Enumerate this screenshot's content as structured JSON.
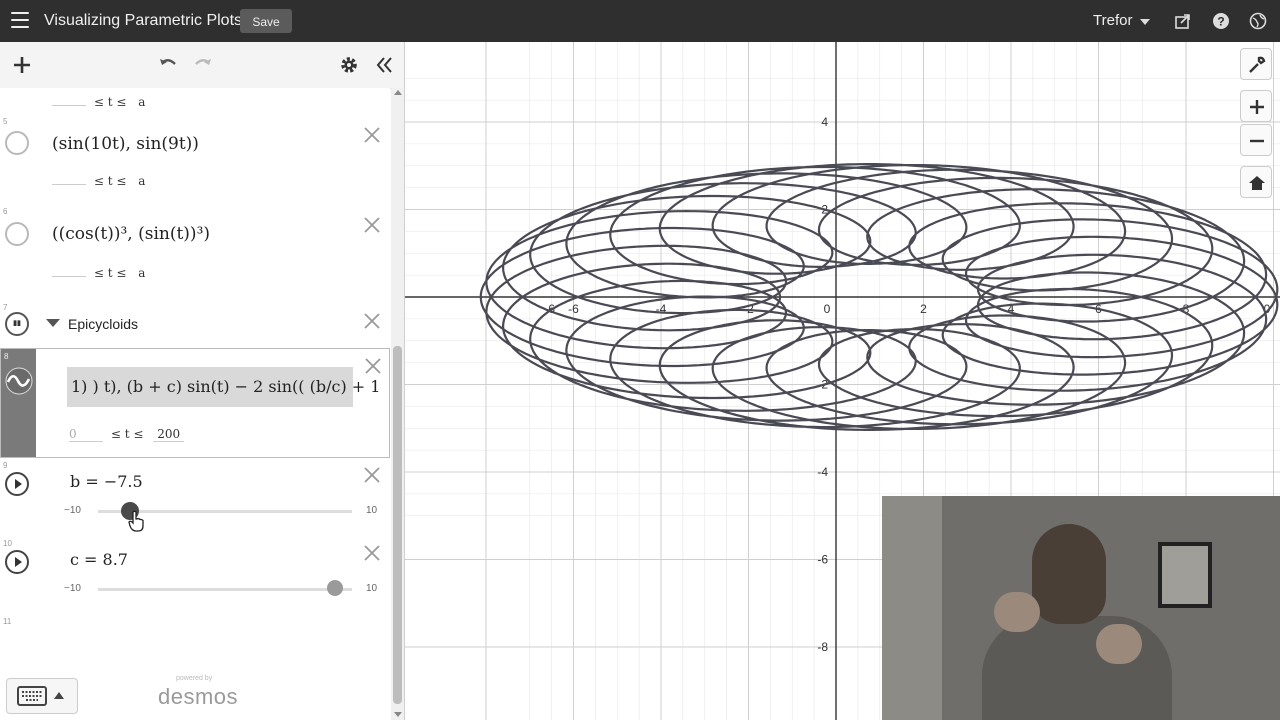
{
  "header": {
    "title": "Visualizing Parametric Plots",
    "save_label": "Save",
    "user": "Trefor"
  },
  "list": {
    "items": [
      {
        "range_hi": "a"
      },
      {
        "num": "5",
        "expr": "(sin(10t), sin(9t))",
        "range_hi": "a"
      },
      {
        "num": "6",
        "expr": "((cos(t))³, (sin(t))³)",
        "range_hi": "a"
      },
      {
        "num": "7",
        "folder": "Epicycloids"
      },
      {
        "num": "8",
        "expr": "1) ) t), (b + c) sin(t) − 2 sin(( (b/c) + 1",
        "range_lo": "0",
        "range_hi": "200"
      },
      {
        "num": "9",
        "expr": "b = −7.5",
        "min": "−10",
        "max": "10",
        "value": -7.5
      },
      {
        "num": "10",
        "expr": "c = 8.7",
        "min": "−10",
        "max": "10",
        "value": 8.7
      },
      {
        "num": "11"
      }
    ],
    "range_op": "≤ t ≤"
  },
  "footer": {
    "powered_by": "powered by",
    "logo": "desmos"
  },
  "graph": {
    "x_ticks": [
      "-6",
      "-4",
      "-2",
      "0",
      "2",
      "4",
      "6",
      "8"
    ],
    "y_ticks": [
      "4",
      "2",
      "-2",
      "-4",
      "-6",
      "-8"
    ],
    "edge_label_left": "6",
    "edge_label_right": "0"
  },
  "colors": {
    "curve": "#4a4a54",
    "grid": "#e6e6e6",
    "header": "#2f2f2f"
  }
}
